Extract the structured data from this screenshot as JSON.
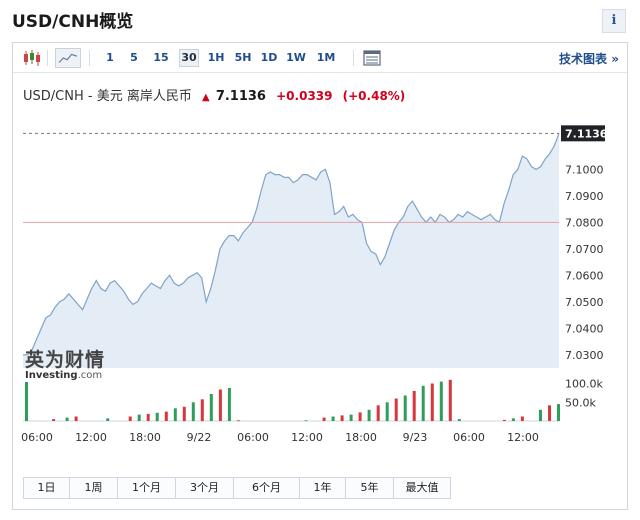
{
  "page": {
    "title": "USD/CNH概览",
    "info_label": "i"
  },
  "toolbar": {
    "intervals": [
      "1",
      "5",
      "15",
      "30",
      "1H",
      "5H",
      "1D",
      "1W",
      "1M"
    ],
    "active_interval": "30",
    "technical_chart_label": "技术图表",
    "technical_chart_arrow": "»"
  },
  "instrument": {
    "name": "USD/CNH - 美元 离岸人民币",
    "direction_arrow": "▲",
    "price": "7.1136",
    "change": "+0.0339",
    "change_pct": "(+0.48%)"
  },
  "watermark": {
    "cn": "英为财情",
    "en_brand": "Investing",
    "en_domain": ".com"
  },
  "chart_data": {
    "type": "area",
    "ylim": [
      7.025,
      7.1175
    ],
    "yticks": [
      7.03,
      7.04,
      7.05,
      7.06,
      7.07,
      7.08,
      7.09,
      7.1
    ],
    "ytick_labels": [
      "7.0300",
      "7.0400",
      "7.0500",
      "7.0600",
      "7.0700",
      "7.0800",
      "7.0900",
      "7.1000"
    ],
    "current_value": 7.1136,
    "current_label": "7.1136",
    "previous_close": 7.08,
    "x_labels": [
      "06:00",
      "12:00",
      "18:00",
      "9/22",
      "06:00",
      "12:00",
      "18:00",
      "9/23",
      "06:00",
      "12:00"
    ],
    "y": [
      7.03,
      7.03,
      7.032,
      7.036,
      7.04,
      7.044,
      7.045,
      7.048,
      7.05,
      7.051,
      7.053,
      7.051,
      7.049,
      7.047,
      7.051,
      7.055,
      7.058,
      7.055,
      7.054,
      7.057,
      7.058,
      7.056,
      7.054,
      7.051,
      7.049,
      7.05,
      7.053,
      7.055,
      7.057,
      7.056,
      7.055,
      7.058,
      7.06,
      7.057,
      7.056,
      7.057,
      7.059,
      7.06,
      7.061,
      7.059,
      7.05,
      7.055,
      7.062,
      7.07,
      7.073,
      7.075,
      7.075,
      7.073,
      7.076,
      7.078,
      7.08,
      7.085,
      7.092,
      7.098,
      7.099,
      7.098,
      7.098,
      7.097,
      7.097,
      7.095,
      7.096,
      7.098,
      7.098,
      7.097,
      7.096,
      7.099,
      7.1,
      7.095,
      7.083,
      7.084,
      7.086,
      7.082,
      7.083,
      7.081,
      7.08,
      7.072,
      7.069,
      7.068,
      7.064,
      7.067,
      7.072,
      7.077,
      7.08,
      7.082,
      7.086,
      7.088,
      7.085,
      7.082,
      7.08,
      7.082,
      7.08,
      7.083,
      7.082,
      7.08,
      7.081,
      7.083,
      7.082,
      7.084,
      7.083,
      7.082,
      7.081,
      7.082,
      7.083,
      7.081,
      7.08,
      7.087,
      7.092,
      7.098,
      7.1,
      7.105,
      7.104,
      7.101,
      7.1,
      7.101,
      7.104,
      7.106,
      7.109,
      7.1136
    ],
    "volume": {
      "ytick_labels": [
        "100.0k",
        "50.0k"
      ],
      "max": 120000,
      "values": [
        104000,
        0,
        0,
        0,
        0,
        0,
        5000,
        0,
        0,
        9000,
        0,
        12000,
        0,
        0,
        0,
        0,
        0,
        0,
        7000,
        0,
        0,
        0,
        0,
        12000,
        0,
        17000,
        0,
        19000,
        0,
        22000,
        0,
        25000,
        0,
        34000,
        0,
        38000,
        0,
        50000,
        0,
        58000,
        0,
        72000,
        0,
        84000,
        0,
        88000,
        0,
        2000,
        0,
        0,
        0,
        0,
        0,
        0,
        0,
        0,
        0,
        0,
        0,
        0,
        0,
        0,
        2000,
        0,
        0,
        0,
        9000,
        0,
        12000,
        0,
        15000,
        0,
        17000,
        0,
        23000,
        0,
        30000,
        0,
        42000,
        0,
        50000,
        0,
        60000,
        0,
        68000,
        0,
        80000,
        0,
        94000,
        0,
        100000,
        0,
        105000,
        0,
        110000,
        0,
        5000,
        0,
        0,
        0,
        0,
        0,
        0,
        0,
        0,
        0,
        3000,
        0,
        7000,
        0,
        12000,
        0,
        0,
        0,
        30000,
        0,
        42000,
        0,
        45000
      ],
      "colors": [
        "#2e9e5b",
        "#d9363e"
      ],
      "color_pattern": "alternating"
    }
  },
  "ranges": [
    "1日",
    "1周",
    "1个月",
    "3个月",
    "6个月",
    "1年",
    "5年",
    "最大值"
  ]
}
